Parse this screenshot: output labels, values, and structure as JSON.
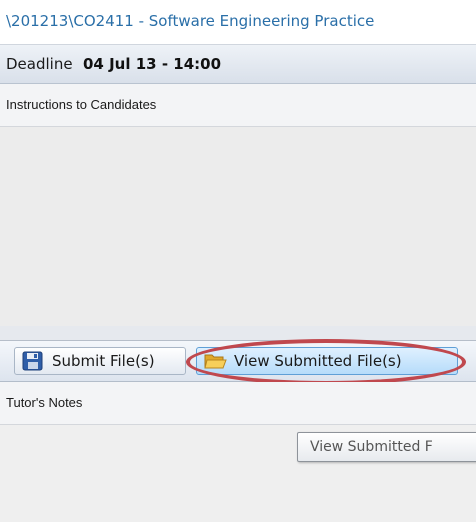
{
  "path": "\\201213\\CO2411 - Software Engineering Practice",
  "deadline": {
    "label": "Deadline",
    "value": "04 Jul 13 - 14:00"
  },
  "instructions": {
    "label": "Instructions to Candidates"
  },
  "toolbar": {
    "submit_label": "Submit File(s)",
    "view_label": "View Submitted File(s)"
  },
  "tutor_notes": {
    "label": "Tutor's Notes"
  },
  "tooltip": {
    "text": "View Submitted F"
  },
  "colors": {
    "path_text": "#2a6fa8",
    "highlight": "#c0484e",
    "view_button_bg": "#b6dcfa"
  },
  "icons": {
    "submit": "floppy-disk-icon",
    "view": "folder-open-icon"
  }
}
